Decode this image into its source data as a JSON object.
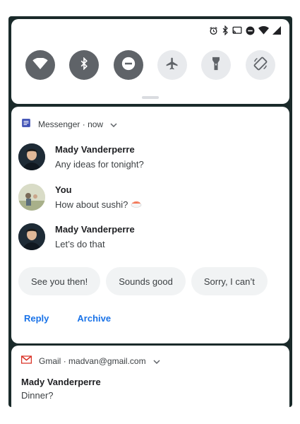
{
  "status_bar": {
    "icons": [
      "alarm-icon",
      "bluetooth-icon",
      "cast-icon",
      "do-not-disturb-icon",
      "wifi-icon",
      "signal-icon"
    ]
  },
  "quick_settings": {
    "tiles": [
      {
        "name": "wifi",
        "icon": "wifi-icon",
        "state": "on"
      },
      {
        "name": "bluetooth",
        "icon": "bluetooth-icon",
        "state": "on"
      },
      {
        "name": "do-not-disturb",
        "icon": "do-not-disturb-icon",
        "state": "on"
      },
      {
        "name": "airplane-mode",
        "icon": "airplane-icon",
        "state": "off"
      },
      {
        "name": "flashlight",
        "icon": "flashlight-icon",
        "state": "off"
      },
      {
        "name": "auto-rotate",
        "icon": "auto-rotate-icon",
        "state": "off"
      }
    ]
  },
  "messenger": {
    "app_name": "Messenger",
    "separator": "·",
    "time": "now",
    "messages": [
      {
        "sender": "Mady Vanderperre",
        "text": "Any ideas for tonight?"
      },
      {
        "sender": "You",
        "text": "How about sushi?"
      },
      {
        "sender": "Mady Vanderperre",
        "text": "Let’s do that"
      }
    ],
    "smart_replies": [
      "See you then!",
      "Sounds good",
      "Sorry, I can’t"
    ],
    "actions": {
      "reply": "Reply",
      "archive": "Archive"
    }
  },
  "gmail": {
    "app_name": "Gmail",
    "separator": "·",
    "account": "madvan@gmail.com",
    "sender": "Mady Vanderperre",
    "subject": "Dinner?"
  },
  "colors": {
    "accent": "#1a73e8",
    "tile_on": "#5f6368",
    "tile_off": "#e8eaed",
    "messenger_icon": "#3f51b5",
    "gmail_icon": "#d93025"
  }
}
